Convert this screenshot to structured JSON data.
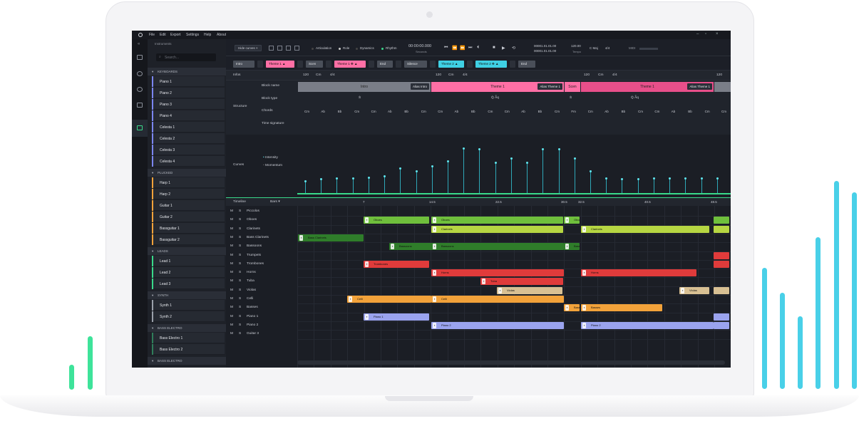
{
  "menu": [
    "File",
    "Edit",
    "Export",
    "Settings",
    "Help",
    "About"
  ],
  "sidebar": {
    "title": "Instruments",
    "search_placeholder": "Search...",
    "groups": [
      {
        "label": "KEYBOARDS",
        "color": "#7b86f0",
        "items": [
          "Piano 1",
          "Piano 2",
          "Piano 3",
          "Piano 4",
          "Celesta 1",
          "Celesta 2",
          "Celesta 3",
          "Celesta 4"
        ]
      },
      {
        "label": "PLUCKED",
        "color": "#f2a23a",
        "items": [
          "Harp 1",
          "Harp 2",
          "Guitar 1",
          "Guitar 2",
          "Bassguitar 1",
          "Bassguitar 2"
        ]
      },
      {
        "label": "LEADS",
        "color": "#39d98a",
        "items": [
          "Lead 1",
          "Lead 2",
          "Lead 3"
        ]
      },
      {
        "label": "SYNTH",
        "color": "#9aa0aa",
        "items": [
          "Synth 1",
          "Synth 2"
        ]
      },
      {
        "label": "BASS ELECTRO",
        "color": "#2f7d5a",
        "items": [
          "Bass Electro 1",
          "Bass Electro 2"
        ]
      },
      {
        "label": "BASS ELECTRO",
        "color": "#2f7d5a",
        "items": []
      }
    ]
  },
  "toolbar": {
    "hide_curves": "Hide curves",
    "close": "×",
    "toggles": [
      "Articulation",
      "Role",
      "Dynamics",
      "Rhythm"
    ],
    "time": "00:00:00.000",
    "time_label": "Seconds",
    "position_1": "00001.01.01.00",
    "position_2": "00001.01.01.00",
    "tempo": "120.00",
    "tempo_label": "Tempo",
    "key": "C Maj",
    "meter": "4/4",
    "midi": "MIDI"
  },
  "blocks": [
    {
      "label": "Intro",
      "style": "gray"
    },
    {
      "label": "Theme 1",
      "style": "pink"
    },
    {
      "label": "Scen",
      "style": "gray"
    },
    {
      "label": "Theme 1",
      "style": "pink"
    },
    {
      "label": "End",
      "style": "gray"
    },
    {
      "label": "Silence",
      "style": "gray"
    },
    {
      "label": "Theme 2",
      "style": "cyan"
    },
    {
      "label": "Theme 2",
      "style": "cyan"
    },
    {
      "label": "End",
      "style": "gray"
    }
  ],
  "info": {
    "label": "Infos",
    "tempo_a": "120",
    "key_a": "Cm",
    "meter_a": "4/4",
    "tempo_b": "120",
    "key_b": "Cm",
    "meter_b": "4/4",
    "tempo_c": "120",
    "key_c": "Cm",
    "meter_c": "4/4",
    "tempo_d": "120"
  },
  "structure": {
    "label": "Structure",
    "rows": [
      "Block name",
      "Block type",
      "Chords",
      "Time signature"
    ],
    "segments": [
      {
        "name": "Intro",
        "alias": "Alias Intro",
        "color": "#7a7e88"
      },
      {
        "name": "Theme 1",
        "alias": "Alias Theme 1",
        "color": "#ff6fa5"
      },
      {
        "name": "Scen",
        "alias": "",
        "color": "#ff6fa5"
      },
      {
        "name": "Theme 1",
        "alias": "Alias Theme 1",
        "color": "#e84f8a"
      }
    ],
    "chords": [
      "Cm",
      "Ab",
      "Bb",
      "Cm",
      "Cm",
      "Ab",
      "Bb",
      "Cm",
      "Cm",
      "Ab",
      "Bb",
      "Cm",
      "Cm",
      "Ab",
      "Bb",
      "Cm",
      "Fm",
      "Cm",
      "Ab",
      "Bb",
      "Cm",
      "Cm",
      "Ab",
      "Bb",
      "Cm",
      "Cm"
    ]
  },
  "curves": {
    "label": "Curves",
    "legend": [
      "Intensity",
      "Momentum"
    ],
    "intensity": [
      0.25,
      0.28,
      0.3,
      0.3,
      0.32,
      0.35,
      0.5,
      0.45,
      0.55,
      0.65,
      0.9,
      0.88,
      0.62,
      0.7,
      0.62,
      0.88,
      0.88,
      0.7,
      0.45,
      0.3,
      0.28,
      0.28,
      0.3,
      0.3,
      0.3,
      0.3,
      0.3
    ]
  },
  "timeline": {
    "label": "Timeline",
    "unit": "Bars",
    "markers": [
      "7",
      "14.5",
      "22.5",
      "30.5",
      "32.5",
      "40.5",
      "48.5"
    ]
  },
  "tracks": [
    "Piccolos",
    "Oboes",
    "Clarinets",
    "Bass Clarinets",
    "Bassoons",
    "Trumpets",
    "Trombones",
    "Horns",
    "Tuba",
    "Violas",
    "Celli",
    "Basses",
    "Piano 1",
    "Piano 2",
    "Guitar 3"
  ],
  "track_m": "M",
  "track_s": "S",
  "clips": [
    {
      "row": 1,
      "text": "Oboes",
      "color": "green"
    },
    {
      "row": 1,
      "text": "Oboes",
      "color": "green"
    },
    {
      "row": 1,
      "text": "Oboes",
      "color": "green"
    },
    {
      "row": 2,
      "text": "Clarinets",
      "color": "yellowgreen"
    },
    {
      "row": 2,
      "text": "Clarinets",
      "color": "yellowgreen"
    },
    {
      "row": 3,
      "text": "Bass Clarinets",
      "color": "dgreen"
    },
    {
      "row": 4,
      "text": "Bassoons",
      "color": "dgreen"
    },
    {
      "row": 4,
      "text": "Bassoons",
      "color": "dgreen"
    },
    {
      "row": 4,
      "text": "Bassoons",
      "color": "dgreen"
    },
    {
      "row": 6,
      "text": "Trombones",
      "color": "red"
    },
    {
      "row": 7,
      "text": "Horns",
      "color": "red"
    },
    {
      "row": 7,
      "text": "Horns",
      "color": "red"
    },
    {
      "row": 8,
      "text": "Tuba",
      "color": "red"
    },
    {
      "row": 9,
      "text": "Violas",
      "color": "tan"
    },
    {
      "row": 9,
      "text": "Violas",
      "color": "tan"
    },
    {
      "row": 10,
      "text": "Celli",
      "color": "orange"
    },
    {
      "row": 10,
      "text": "Celli",
      "color": "orange"
    },
    {
      "row": 11,
      "text": "Basses",
      "color": "orange"
    },
    {
      "row": 11,
      "text": "Basses",
      "color": "orange"
    },
    {
      "row": 12,
      "text": "Piano 1",
      "color": "lavender"
    },
    {
      "row": 13,
      "text": "Piano 2",
      "color": "lavender"
    },
    {
      "row": 13,
      "text": "Piano 2",
      "color": "lavender"
    }
  ]
}
